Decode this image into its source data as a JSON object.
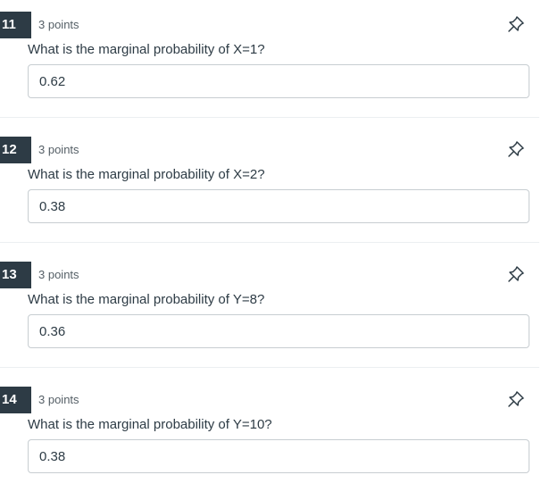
{
  "questions": [
    {
      "number": "11",
      "points": "3 points",
      "text": "What is the marginal probability of X=1?",
      "answer": "0.62"
    },
    {
      "number": "12",
      "points": "3 points",
      "text": "What is the marginal probability of X=2?",
      "answer": "0.38"
    },
    {
      "number": "13",
      "points": "3 points",
      "text": "What is the marginal probability of Y=8?",
      "answer": "0.36"
    },
    {
      "number": "14",
      "points": "3 points",
      "text": "What is the marginal probability of Y=10?",
      "answer": "0.38"
    }
  ],
  "icons": {
    "pin": "pin-icon"
  },
  "colors": {
    "number_badge": "#2d3b45",
    "text": "#2d3b45",
    "border": "#c7cdd1"
  }
}
